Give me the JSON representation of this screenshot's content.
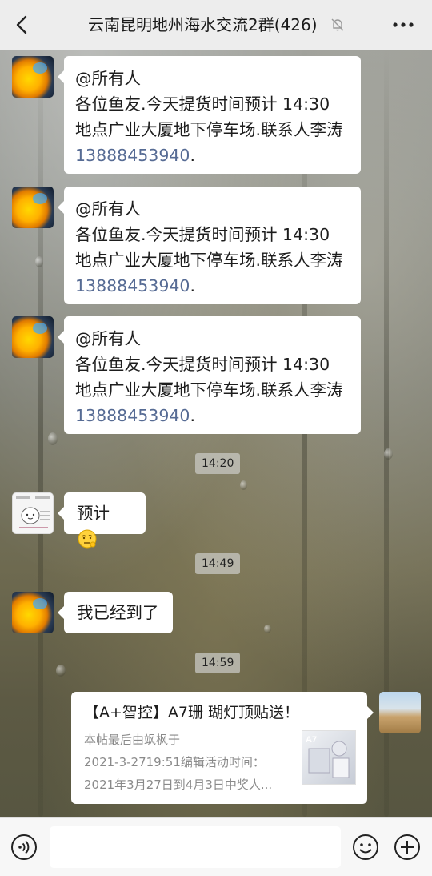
{
  "header": {
    "title": "云南昆明地州海水交流2群(426)"
  },
  "messages": {
    "m1": {
      "line1": "@所有人",
      "line2": "各位鱼友.今天提货时间预计 14:30",
      "line3": "地点广业大厦地下停车场.联系人李涛",
      "phone": "13888453940",
      "dot": "."
    },
    "m2": {
      "line1": "@所有人",
      "line2": "各位鱼友.今天提货时间预计 14:30",
      "line3": "地点广业大厦地下停车场.联系人李涛",
      "phone": "13888453940",
      "dot": "."
    },
    "m3": {
      "line1": "@所有人",
      "line2": "各位鱼友.今天提货时间预计 14:30",
      "line3": "地点广业大厦地下停车场.联系人李涛",
      "phone": "13888453940",
      "dot": "."
    },
    "time1": "14:20",
    "m4": {
      "text": "预计"
    },
    "time2": "14:49",
    "m5": {
      "text": "我已经到了"
    },
    "time3": "14:59",
    "card": {
      "title": "【A+智控】A7珊 瑚灯顶贴送！",
      "desc_line1": "本帖最后由飒枫于",
      "desc_line2": "2021-3-2719:51编辑活动时间：",
      "desc_line3": "2021年3月27日到4月3日中奖人..."
    }
  },
  "icons": {
    "back": "chevron-left-icon",
    "mute": "bell-off-icon",
    "more": "more-dots-icon",
    "voice": "voice-icon",
    "emoji": "emoji-icon",
    "plus": "plus-icon"
  }
}
